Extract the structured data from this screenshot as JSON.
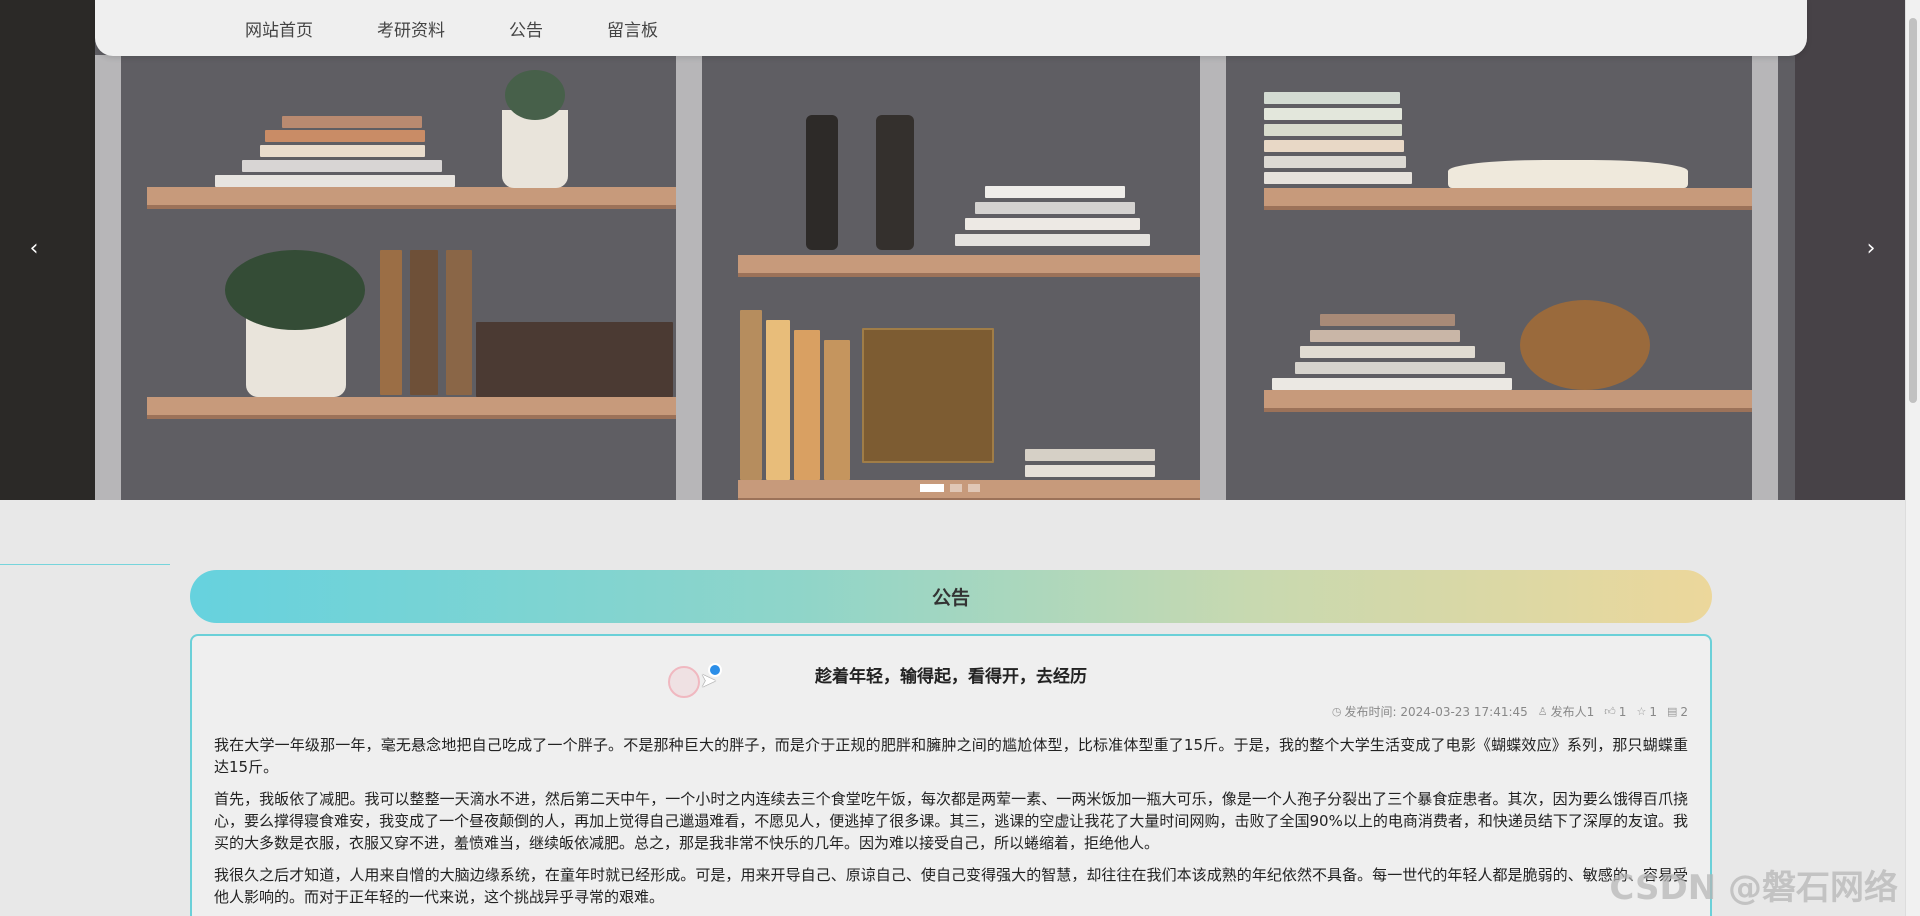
{
  "nav": {
    "items": [
      {
        "label": "网站首页"
      },
      {
        "label": "考研资料"
      },
      {
        "label": "公告"
      },
      {
        "label": "留言板"
      }
    ]
  },
  "carousel": {
    "prev_icon": "chevron-left-icon",
    "prev_glyph": "‹",
    "next_icon": "chevron-right-icon",
    "next_glyph": "›",
    "slide_count": 3,
    "active_index": 0
  },
  "notice": {
    "header": "公告"
  },
  "article": {
    "title": "趁着年轻，输得起，看得开，去经历",
    "meta": {
      "publish_time": "发布时间: 2024-03-23 17:41:45",
      "publisher": "发布人1",
      "likes": "1",
      "favorites": "1",
      "comments": "2"
    },
    "paragraphs": [
      "我在大学一年级那一年，毫无悬念地把自己吃成了一个胖子。不是那种巨大的胖子，而是介于正规的肥胖和臃肿之间的尴尬体型，比标准体型重了15斤。于是，我的整个大学生活变成了电影《蝴蝶效应》系列，那只蝴蝶重达15斤。",
      "首先，我皈依了减肥。我可以整整一天滴水不进，然后第二天中午，一个小时之内连续去三个食堂吃午饭，每次都是两荤一素、一两米饭加一瓶大可乐，像是一个人孢子分裂出了三个暴食症患者。其次，因为要么饿得百爪挠心，要么撑得寝食难安，我变成了一个昼夜颠倒的人，再加上觉得自己邋遢难看，不愿见人，便逃掉了很多课。其三，逃课的空虚让我花了大量时间网购，击败了全国90%以上的电商消费者，和快递员结下了深厚的友谊。我买的大多数是衣服，衣服又穿不进，羞愤难当，继续皈依减肥。总之，那是我非常不快乐的几年。因为难以接受自己，所以蜷缩着，拒绝他人。",
      "我很久之后才知道，人用来自憎的大脑边缘系统，在童年时就已经形成。可是，用来开导自己、原谅自己、使自己变得强大的智慧，却往往在我们本该成熟的年纪依然不具备。每一世代的年轻人都是脆弱的、敏感的、容易受他人影响的。而对于正年轻的一代来说，这个挑战异乎寻常的艰难。"
    ]
  },
  "watermark": "CSDN @磐石网络"
}
